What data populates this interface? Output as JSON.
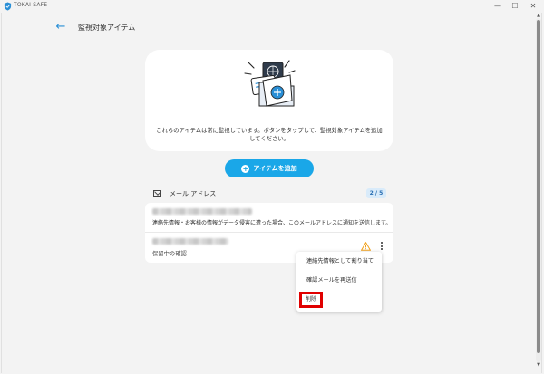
{
  "app": {
    "title": "TOKAI SAFE",
    "minimize": "—",
    "maximize": "☐",
    "close": "✕"
  },
  "header": {
    "back": "←",
    "title": "監視対象アイテム"
  },
  "hero": {
    "description": "これらのアイテムは常に監視しています。ボタンをタップして、監視対象アイテムを追加してください。"
  },
  "add_button": {
    "label": "アイテムを追加",
    "icon": "plus-circle-icon"
  },
  "section": {
    "label": "メール アドレス",
    "count": "2 / 5"
  },
  "items": [
    {
      "description": "連絡先情報・お客様の情報がデータ侵害に遭った場合、このメールアドレスに通知を送信します。"
    },
    {
      "status": "保留中の確認"
    }
  ],
  "menu": {
    "assign": "連絡先情報として割り当て",
    "resend": "確認メールを再送信",
    "delete": "削除"
  },
  "colors": {
    "accent": "#1aa7e8",
    "warning": "#f0a11c",
    "highlight": "#e00000"
  }
}
